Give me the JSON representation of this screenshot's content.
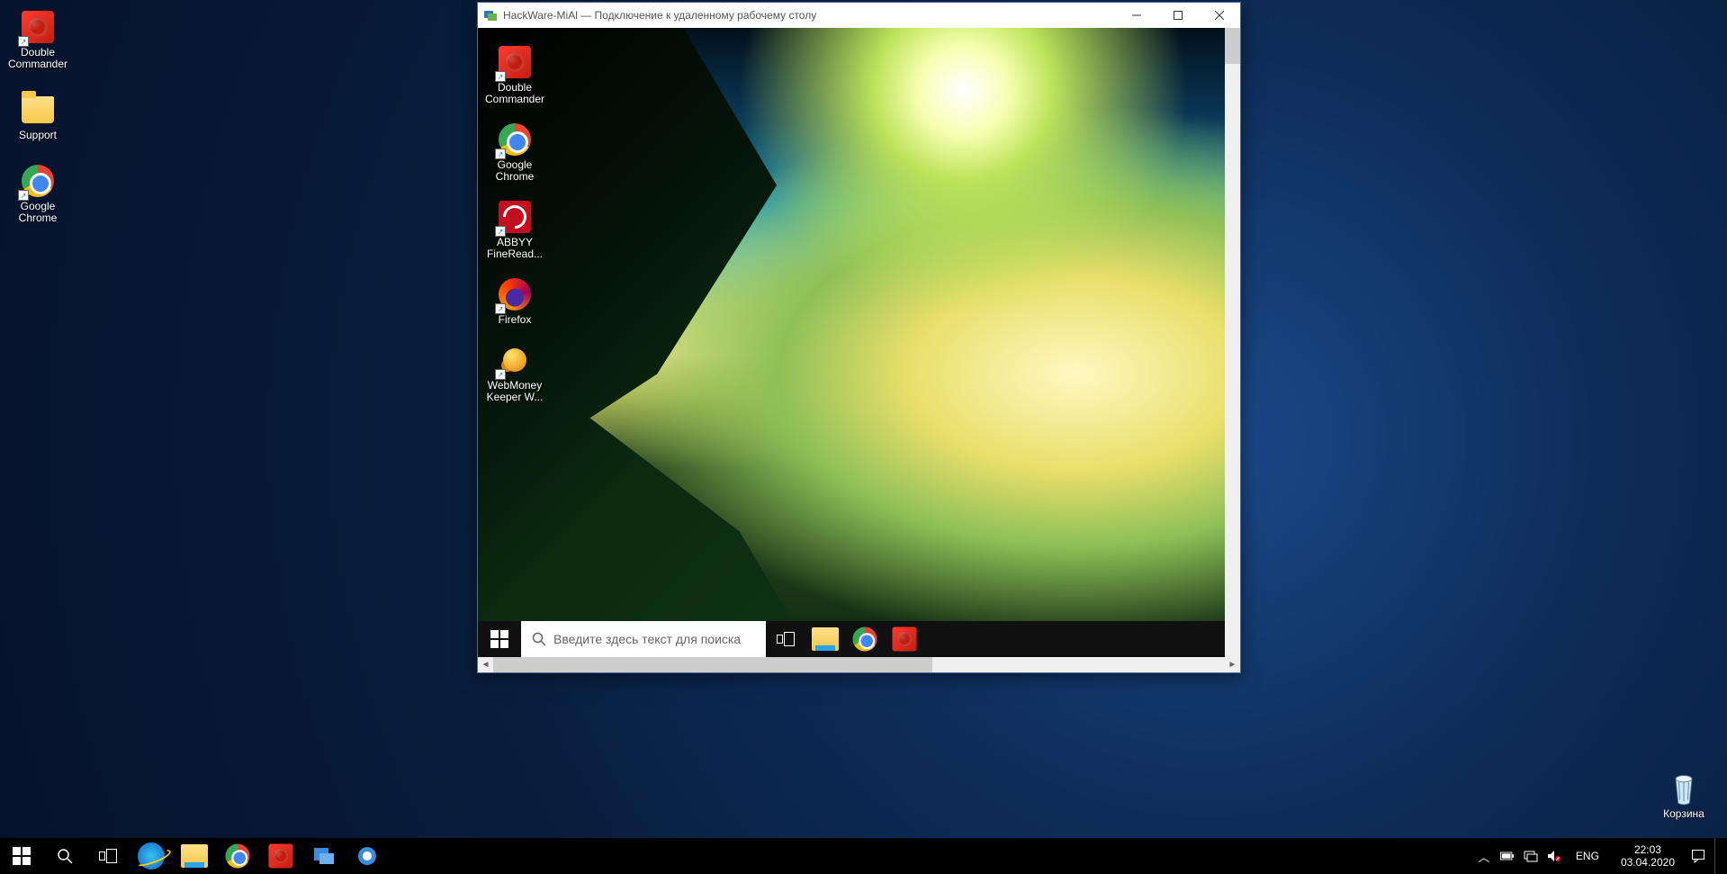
{
  "host": {
    "icons": [
      {
        "key": "double-commander",
        "label": "Double Commander",
        "kind": "dc",
        "shortcut": true
      },
      {
        "key": "support-folder",
        "label": "Support",
        "kind": "folder",
        "shortcut": false
      },
      {
        "key": "google-chrome",
        "label": "Google Chrome",
        "kind": "chrome",
        "shortcut": true
      }
    ],
    "recycle": {
      "label": "Корзина"
    },
    "taskbar_apps": [
      {
        "key": "start",
        "kind": "win"
      },
      {
        "key": "search",
        "kind": "search"
      },
      {
        "key": "taskview",
        "kind": "taskview"
      },
      {
        "key": "ie",
        "kind": "ie"
      },
      {
        "key": "explorer",
        "kind": "explorer"
      },
      {
        "key": "chrome",
        "kind": "chrome"
      },
      {
        "key": "dc",
        "kind": "dc"
      },
      {
        "key": "app1",
        "kind": "generic1"
      },
      {
        "key": "app2",
        "kind": "generic2"
      }
    ],
    "tray": {
      "lang": "ENG",
      "time": "22:03",
      "date": "03.04.2020"
    }
  },
  "rdp": {
    "title": "HackWare-MiAl — Подключение к удаленному рабочему столу",
    "remote_icons": [
      {
        "key": "double-commander",
        "label": "Double Commander",
        "kind": "dc",
        "shortcut": true
      },
      {
        "key": "google-chrome",
        "label": "Google Chrome",
        "kind": "chrome",
        "shortcut": true
      },
      {
        "key": "abbyy",
        "label": "ABBYY FineRead...",
        "kind": "abbyy",
        "shortcut": true
      },
      {
        "key": "firefox",
        "label": "Firefox",
        "kind": "firefox",
        "shortcut": true
      },
      {
        "key": "webmoney",
        "label": "WebMoney Keeper W...",
        "kind": "webmoney",
        "shortcut": true
      }
    ],
    "search_placeholder": "Введите здесь текст для поиска",
    "remote_taskbar_apps": [
      {
        "key": "taskview",
        "kind": "taskview"
      },
      {
        "key": "explorer",
        "kind": "explorer"
      },
      {
        "key": "chrome",
        "kind": "chrome"
      },
      {
        "key": "dc",
        "kind": "dc"
      }
    ]
  }
}
